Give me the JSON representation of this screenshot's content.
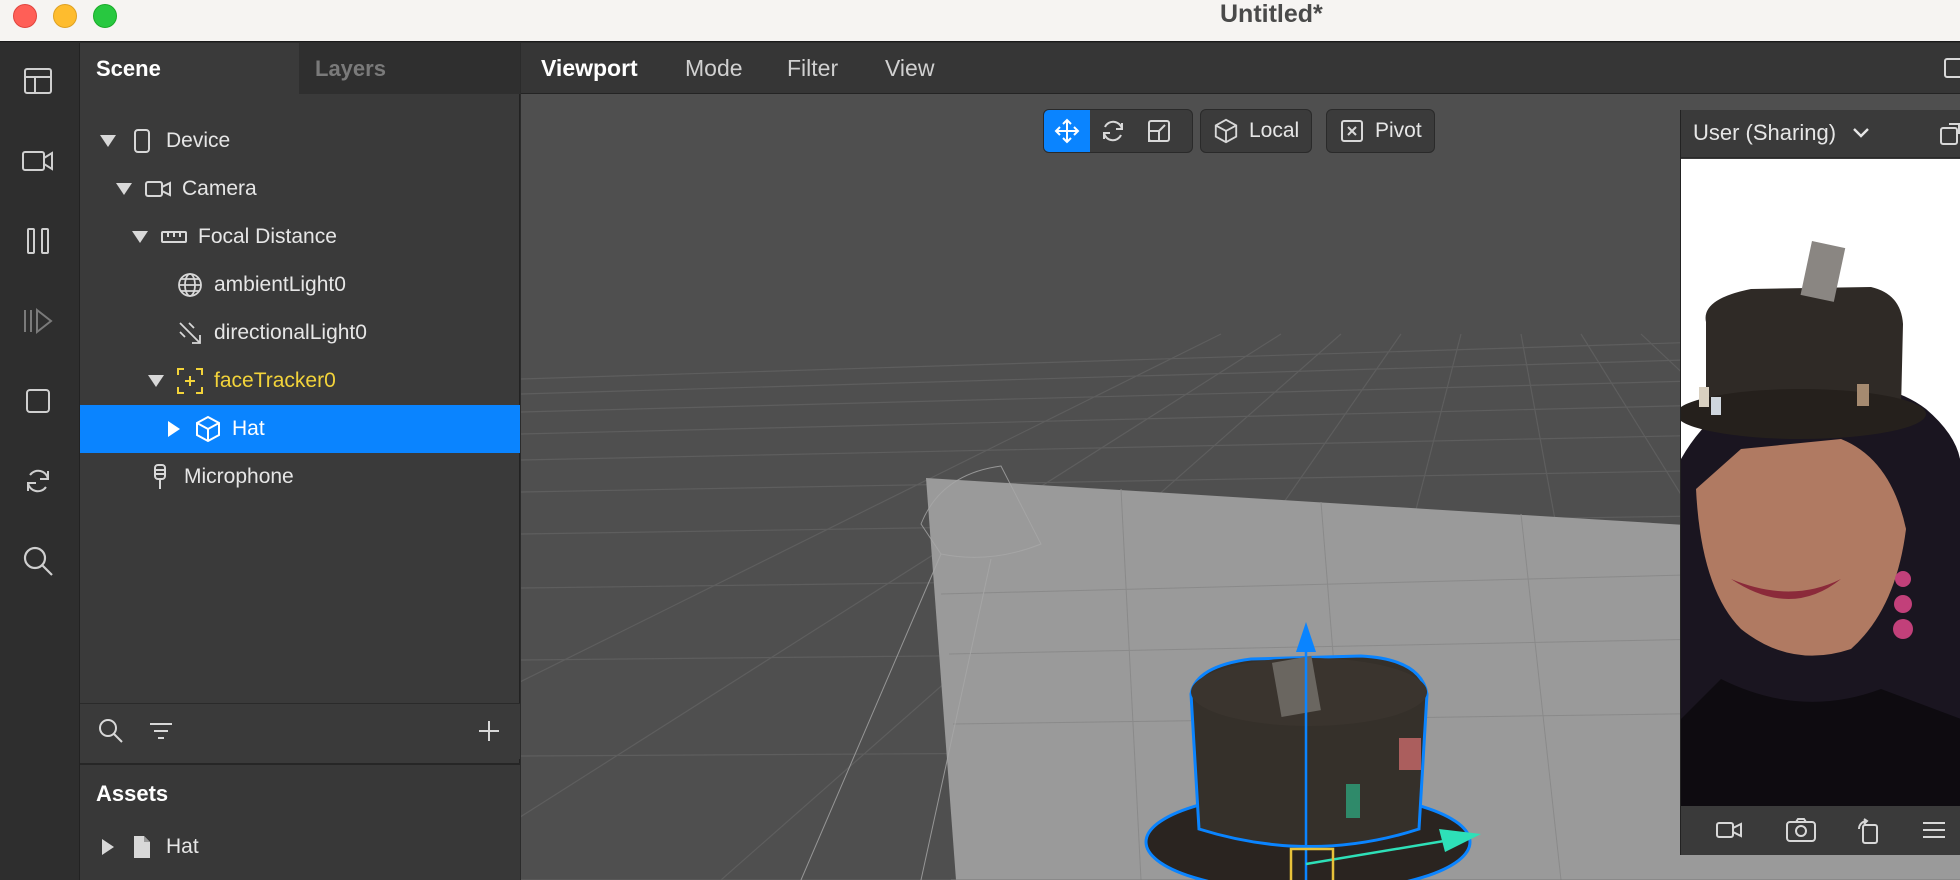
{
  "window": {
    "title": "Untitled*"
  },
  "panel": {
    "tabs": [
      "Scene",
      "Layers"
    ],
    "tree": [
      {
        "label": "Device",
        "icon": "phone-icon",
        "level": 0,
        "expanded": true
      },
      {
        "label": "Camera",
        "icon": "camera-icon",
        "level": 1,
        "expanded": true
      },
      {
        "label": "Focal Distance",
        "icon": "ruler-icon",
        "level": 2,
        "expanded": true
      },
      {
        "label": "ambientLight0",
        "icon": "globe-icon",
        "level": 3
      },
      {
        "label": "directionalLight0",
        "icon": "directional-light-icon",
        "level": 3
      },
      {
        "label": "faceTracker0",
        "icon": "face-tracker-icon",
        "level": 3,
        "expanded": true
      },
      {
        "label": "Hat",
        "icon": "cube-icon",
        "level": 4,
        "collapsed": true,
        "selected": true
      },
      {
        "label": "Microphone",
        "icon": "microphone-icon",
        "level": 1
      }
    ],
    "assets": {
      "title": "Assets",
      "items": [
        {
          "label": "Hat",
          "icon": "file-icon"
        }
      ]
    }
  },
  "viewport": {
    "menus": [
      "Viewport",
      "Mode",
      "Filter",
      "View"
    ],
    "toolbar": {
      "space_label": "Local",
      "pivot_label": "Pivot"
    }
  },
  "preview": {
    "device": "User (Sharing)"
  },
  "colors": {
    "accent": "#0a84ff",
    "tracker": "#f2d33a"
  }
}
